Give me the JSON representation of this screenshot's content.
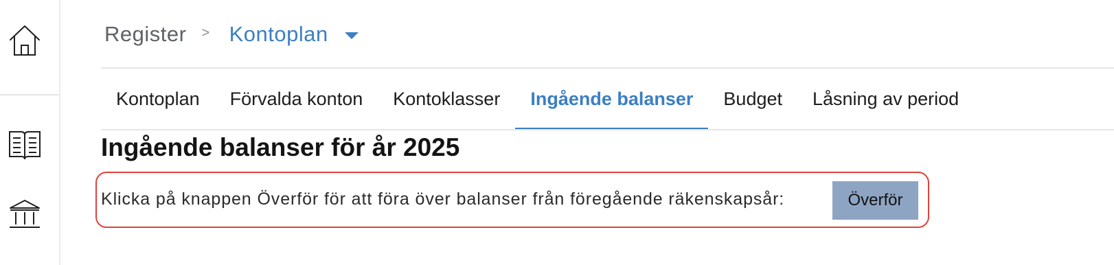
{
  "sidebar": {
    "icons": [
      "home-icon",
      "book-icon",
      "bank-icon"
    ]
  },
  "breadcrumb": {
    "root": "Register",
    "separator": ">",
    "current": "Kontoplan"
  },
  "tabs": [
    {
      "label": "Kontoplan",
      "active": false
    },
    {
      "label": "Förvalda konton",
      "active": false
    },
    {
      "label": "Kontoklasser",
      "active": false
    },
    {
      "label": "Ingående balanser",
      "active": true
    },
    {
      "label": "Budget",
      "active": false
    },
    {
      "label": "Låsning av period",
      "active": false
    }
  ],
  "main": {
    "title": "Ingående balanser för år 2025",
    "instruction": "Klicka på knappen Överför för att föra över balanser från föregående räkenskapsår:",
    "transfer_button": "Överför"
  },
  "colors": {
    "accent": "#3b7fc4",
    "button": "#8ea4c3",
    "highlight_border": "#e0423a"
  }
}
